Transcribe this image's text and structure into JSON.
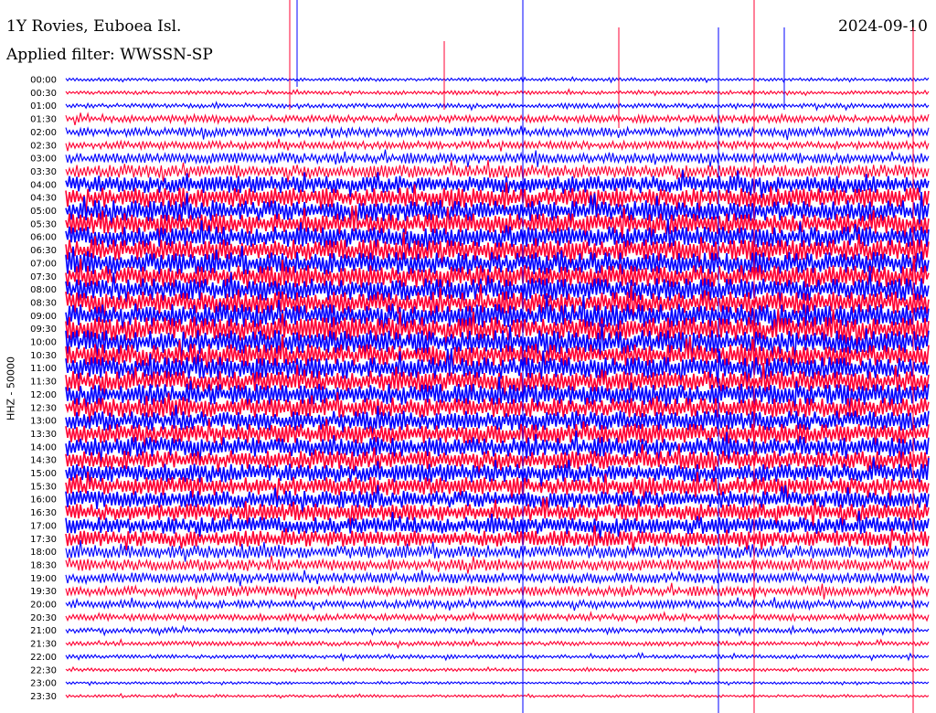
{
  "header": {
    "title": "1Y Rovies, Euboea Isl.",
    "date": "2024-09-10",
    "filter": "Applied filter: WWSSN-SP"
  },
  "chart_data": {
    "type": "line",
    "title": "1Y Rovies, Euboea Isl.",
    "subtitle": "Applied filter: WWSSN-SP",
    "ylabel": "HHZ - 50000",
    "xlabel": "",
    "date": "2024-09-10",
    "series_colors": [
      "#0000ff",
      "#ff0033"
    ],
    "categories": [
      "00:00",
      "00:30",
      "01:00",
      "01:30",
      "02:00",
      "02:30",
      "03:00",
      "03:30",
      "04:00",
      "04:30",
      "05:00",
      "05:30",
      "06:00",
      "06:30",
      "07:00",
      "07:30",
      "08:00",
      "08:30",
      "09:00",
      "09:30",
      "10:00",
      "10:30",
      "11:00",
      "11:30",
      "12:00",
      "12:30",
      "13:00",
      "13:30",
      "14:00",
      "14:30",
      "15:00",
      "15:30",
      "16:00",
      "16:30",
      "17:00",
      "17:30",
      "18:00",
      "18:30",
      "19:00",
      "19:30",
      "20:00",
      "20:30",
      "21:00",
      "21:30",
      "22:00",
      "22:30",
      "23:00",
      "23:30"
    ],
    "noise_level": [
      0.25,
      0.28,
      0.35,
      0.55,
      0.7,
      0.6,
      0.8,
      1.0,
      1.3,
      1.5,
      1.6,
      1.6,
      1.6,
      1.6,
      1.7,
      1.7,
      1.7,
      1.7,
      1.8,
      1.8,
      1.8,
      1.7,
      1.7,
      1.6,
      1.6,
      1.5,
      1.5,
      1.5,
      1.5,
      1.4,
      1.4,
      1.4,
      1.3,
      1.3,
      1.3,
      1.2,
      1.0,
      0.9,
      0.8,
      0.75,
      0.6,
      0.5,
      0.4,
      0.35,
      0.3,
      0.25,
      0.2,
      0.2
    ],
    "grid": false
  }
}
